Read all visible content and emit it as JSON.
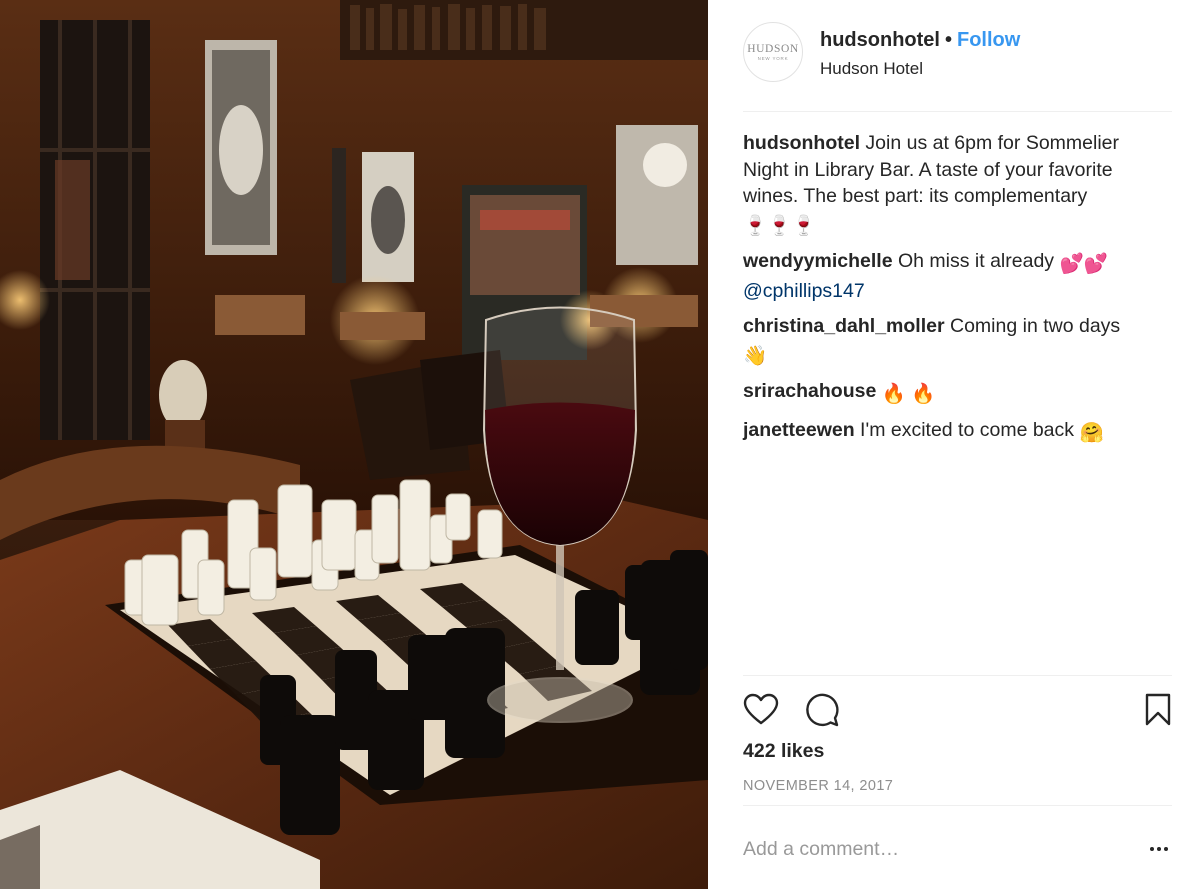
{
  "post": {
    "photo_description_icon": "chess-wine-photo",
    "header": {
      "avatar_brand": "HUDSON",
      "avatar_sub": "NEW YORK",
      "username": "hudsonhotel",
      "separator": "•",
      "follow_label": "Follow",
      "location": "Hudson Hotel"
    },
    "comments": [
      {
        "user": "hudsonhotel",
        "text": "Join us at 6pm for Sommelier Night in Library Bar. A taste of your favorite wines. The best part: its complementary",
        "emoji": "🍷🍷🍷"
      },
      {
        "user": "wendyymichelle",
        "text": "Oh miss it already",
        "emoji": "💕💕",
        "mention": "@cphillips147"
      },
      {
        "user": "christina_dahl_moller",
        "text": "Coming in two days",
        "emoji": "👋"
      },
      {
        "user": "srirachahouse",
        "text": "",
        "emoji": "🔥 🔥"
      },
      {
        "user": "janetteewen",
        "text": "I'm excited to come back",
        "emoji": "🤗"
      }
    ],
    "likes_label": "422 likes",
    "date": "NOVEMBER 14, 2017",
    "comment_placeholder": "Add a comment…",
    "icons": {
      "like": "heart-icon",
      "comment": "comment-icon",
      "save": "bookmark-icon",
      "more": "more-options-icon"
    },
    "colors": {
      "follow": "#3897f0",
      "mention": "#003569",
      "muted": "#8e8e8e",
      "text": "#262626",
      "divider": "#efefef"
    }
  }
}
